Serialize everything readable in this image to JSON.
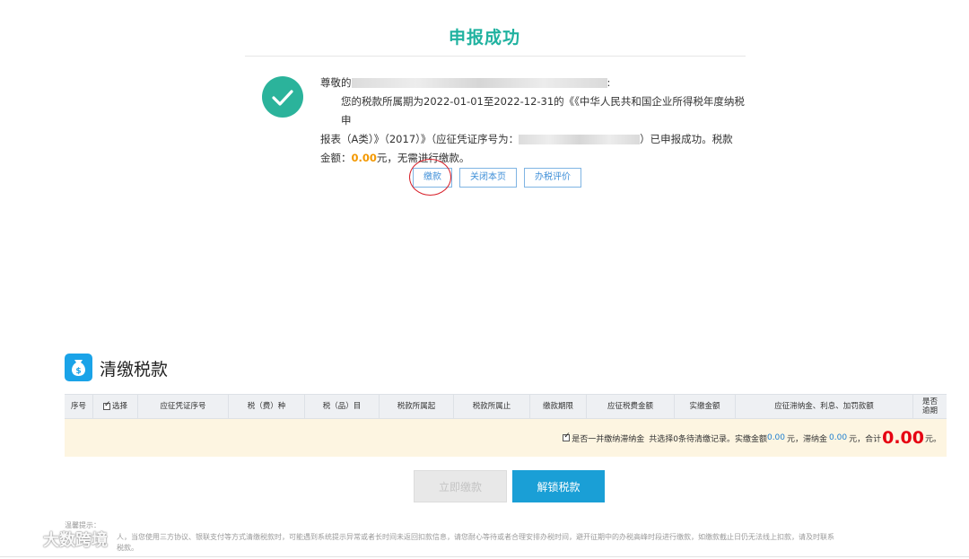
{
  "page_title": "申报成功",
  "message": {
    "salutation_prefix": "尊敬的",
    "salutation_suffix": ":",
    "line1_prefix": "您的税款所属期为2022-01-01至2022-12-31的《《中华人民共和国企业所得税年度纳税申",
    "line2_prefix": "报表（A类）》（2017）》（应征凭证序号为：",
    "line2_suffix": "）已申报成功。税款",
    "line3_prefix": "金额：",
    "amount": "0.00",
    "line3_suffix": "元，无需进行缴款。"
  },
  "actions": {
    "pay": "缴款",
    "close": "关闭本页",
    "rate": "办税评价"
  },
  "section": {
    "title": "清缴税款",
    "icon": "money-bag-icon"
  },
  "table": {
    "headers": [
      "序号",
      "选择",
      "应征凭证序号",
      "税（费）种",
      "税（品）目",
      "税款所属起",
      "税款所属止",
      "缴款期限",
      "应征税费金额",
      "实缴金额",
      "应征滞纳金、利息、加罚款额",
      "是否逾期"
    ],
    "summary": {
      "checkbox_label": "是否一并缴纳滞纳金",
      "records_text": "共选择0条待清缴记录。实缴金额",
      "paid_amount": "0.00",
      "paid_unit": "元，滞纳金",
      "late_fee": "0.00",
      "late_unit": "元，合计",
      "total": "0.00",
      "total_unit": "元。"
    }
  },
  "buttons": {
    "pay_now": "立即缴款",
    "unlock": "解锁税款"
  },
  "tips": {
    "title": "温馨提示：",
    "body": "人，当您使用三方协议、银联支付等方式清缴税款时，可能遇到系统提示异常或者长时间未返回扣款信息，请您耐心等待或者合理安排办税时间，避开征期中的办税高峰时段进行缴款，如缴款截止日仍无法线上扣款，请及时联系",
    "body_line2": "税款。"
  },
  "watermark": {
    "text": "大数跨境"
  },
  "colors": {
    "accent_teal": "#20b2a0",
    "check_green": "#2bb39b",
    "primary_blue": "#1a9fd6",
    "amount_orange": "#f39800",
    "total_red": "#e60012",
    "annotation_red": "#d8202a"
  }
}
